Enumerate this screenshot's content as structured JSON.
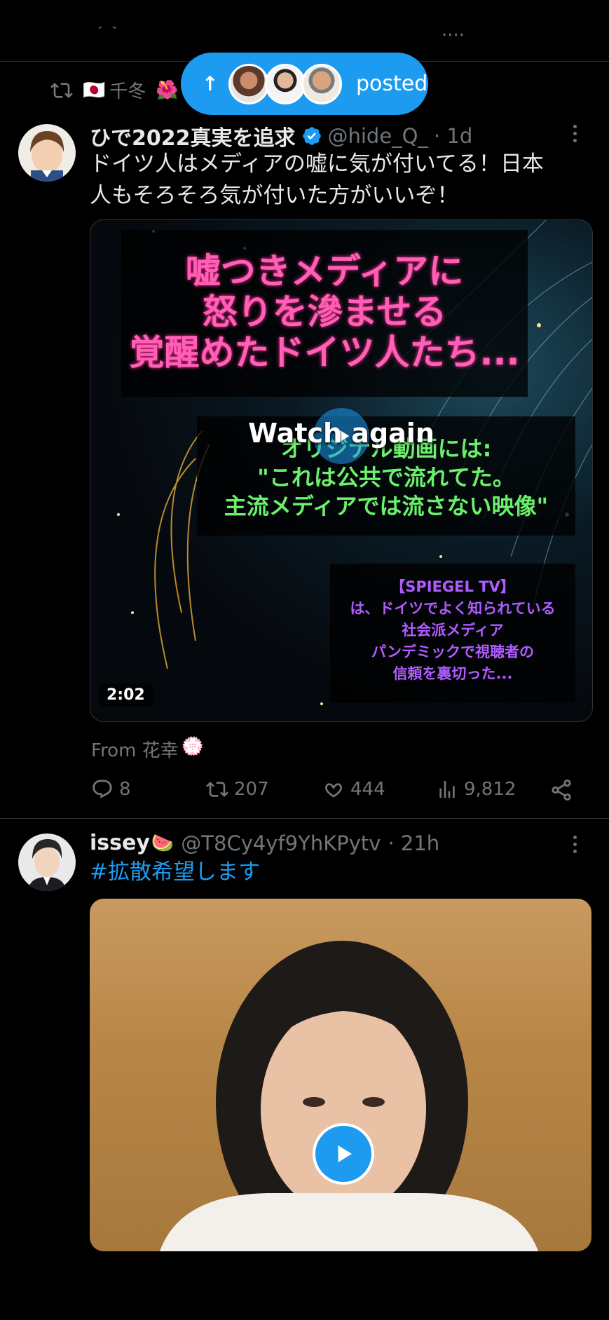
{
  "new_posts_pill": {
    "arrow": "↑",
    "label": "posted"
  },
  "retweet": {
    "flag": "🇯🇵",
    "name": "千冬",
    "flower": "🌺"
  },
  "tweet1": {
    "display_name": "ひで2022真実を追求",
    "handle": "@hide_Q_",
    "time": "· 1d",
    "text_line1": "ドイツ人はメディアの嘘に気が付いてる！日本",
    "text_line2": "人もそろそろ気が付いた方がいいぞ！",
    "video": {
      "title_lines": [
        "嘘つきメディアに",
        "怒りを滲ませる",
        "覚醒めたドイツ人たち..."
      ],
      "green_lines": [
        "オリジナル動画には:",
        "\"これは公共で流れてた。",
        "主流メディアでは流さない映像\""
      ],
      "purple_lines": [
        "【SPIEGEL TV】",
        "は、ドイツでよく知られている",
        "社会派メディア",
        "パンデミックで視聴者の",
        "信頼を裏切った..."
      ],
      "overlay": "Watch again",
      "duration": "2:02"
    },
    "from_label": "From 花幸",
    "from_emoji": "💮",
    "stats": {
      "replies": "8",
      "retweets": "207",
      "likes": "444",
      "views": "9,812"
    }
  },
  "tweet2": {
    "display_name": "issey",
    "emoji": "🍉",
    "handle": "@T8Cy4yf9YhKPytv",
    "time": "· 21h",
    "text": "#拡散希望します"
  },
  "colors": {
    "accent": "#1d9bf0",
    "muted": "#71767b",
    "background": "#000000"
  }
}
